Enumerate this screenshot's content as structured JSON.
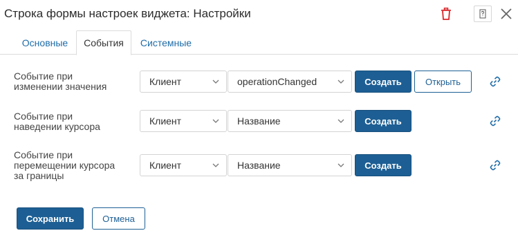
{
  "dialog": {
    "title": "Строка формы настроек виджета: Настройки"
  },
  "tabs": [
    {
      "label": "Основные",
      "active": false
    },
    {
      "label": "События",
      "active": true
    },
    {
      "label": "Системные",
      "active": false
    }
  ],
  "events": [
    {
      "label": "Событие при изменении значения",
      "label_lines": [
        "Событие при",
        "изменении значения"
      ],
      "source": "Клиент",
      "handler": "operationChanged",
      "create_label": "Создать",
      "open_label": "Открыть"
    },
    {
      "label": "Событие при наведении курсора",
      "label_lines": [
        "Событие при",
        "наведении курсора"
      ],
      "source": "Клиент",
      "handler": "Название",
      "create_label": "Создать"
    },
    {
      "label": "Событие при перемещении курсора за границы",
      "label_lines": [
        "Событие при",
        "перемещении курсора",
        "за границы"
      ],
      "source": "Клиент",
      "handler": "Название",
      "create_label": "Создать"
    }
  ],
  "footer": {
    "save_label": "Сохранить",
    "cancel_label": "Отмена"
  },
  "colors": {
    "primary": "#1d5f94",
    "link": "#1f6ca8",
    "delete": "#d9252a"
  },
  "icons": {
    "delete": "trash-icon",
    "help": "help-icon",
    "close": "close-icon",
    "link": "link-icon",
    "dropdown": "chevron-down-icon"
  }
}
